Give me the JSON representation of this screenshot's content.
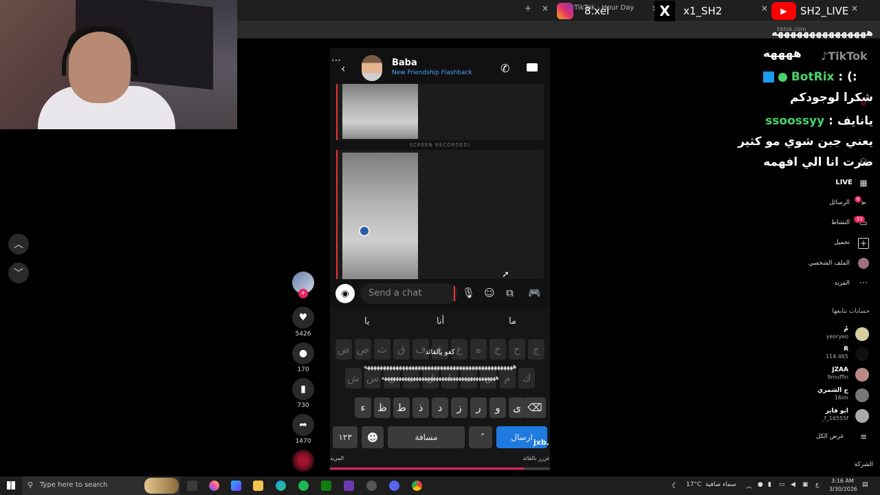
{
  "browser": {
    "tabs": [
      {
        "label": "TikTok · Hour Day"
      },
      {
        "label": "instagram"
      },
      {
        "label": "8.xel"
      },
      {
        "label": "x1_SH2"
      },
      {
        "label": "SH2_LIVE"
      }
    ],
    "address": "tiktok.com"
  },
  "overlays": {
    "instagram_handle": "8.xel",
    "x_handle": "x1_SH2",
    "youtube_handle": "SH2_LIVE",
    "tiktok_logo": "TikTok",
    "bottom_handle": "jxb.1_"
  },
  "phone": {
    "contact_name": "Baba",
    "contact_sub": "New Friendship Flashback",
    "screen_recorded": "SCREEN RECORDED!",
    "input_placeholder": "Send a chat",
    "suggestions": [
      "ما",
      "أنا",
      "يا"
    ],
    "row1": [
      "ج",
      "ح",
      "خ",
      "ه",
      "ع",
      "غ",
      "ف",
      "ق",
      "ث",
      "ص",
      "ض"
    ],
    "row2": [
      "ك",
      "م",
      "ن",
      "ت",
      "ا",
      "ل",
      "ب",
      "ي",
      "س",
      "ش"
    ],
    "row3": [
      "ى",
      "و",
      "ر",
      "ز",
      "د",
      "ذ",
      "ط",
      "ظ",
      "ء"
    ],
    "num_key": "١٢٣",
    "space_key": "مسافة",
    "send_key": "ارسال",
    "overlay_msg1": "كفو يالقائد",
    "overlay_msg2": "هههههههههههههههههههههههههههههههههههههههههههههههه",
    "overlay_msg3": "ههههههههههههههههههههههههههههههههههههههههه",
    "bottom_left": "المزيد",
    "bottom_right": "عززز بالقائد",
    "progress": 0.86
  },
  "actions": {
    "likes": "5426",
    "comments": "170",
    "saves": "730",
    "shares": "1470"
  },
  "live_chat": {
    "line1": "هههههههههههههههه",
    "line2": "ههههه",
    "botrix_name": "BotRix",
    "botrix_msg": ": (:",
    "line4": "شكرا لوجودكم",
    "user_name": "ssoossyy",
    "user_msg": ": يانايف",
    "line6": "يعني جبن شوي مو كثير",
    "line7": "صرت انا الي افهمه"
  },
  "tiktok_side": {
    "live": "LIVE",
    "messages": "الرسائل",
    "messages_badge": "6",
    "activity": "النشاط",
    "activity_badge": "33",
    "upload": "تحميل",
    "profile": "الملف الشخصي",
    "more": "المزيد",
    "following_title": "حسابات تتابعها",
    "accounts": [
      {
        "name": "مُ",
        "sub": "yeoryeo"
      },
      {
        "name": "R",
        "sub": "114.465"
      },
      {
        "name": "JZAA",
        "sub": "9muffin"
      },
      {
        "name": "ج الشمري",
        "sub": "16im"
      },
      {
        "name": "ابو فايز",
        "sub": "_f_16555f"
      }
    ],
    "see_all": "عرض الكل",
    "company": "الشركة"
  },
  "taskbar": {
    "search_placeholder": "Type here to search",
    "weather_temp": "17°C",
    "weather_text": "سماء صافية",
    "lang": "ع",
    "time": "3:16 AM",
    "date": "3/30/2026"
  },
  "colors": {
    "accent_pink": "#e0245e",
    "send_blue": "#1f7ae0",
    "botrix_green": "#4bd36b",
    "link_blue": "#4aa3ff"
  }
}
